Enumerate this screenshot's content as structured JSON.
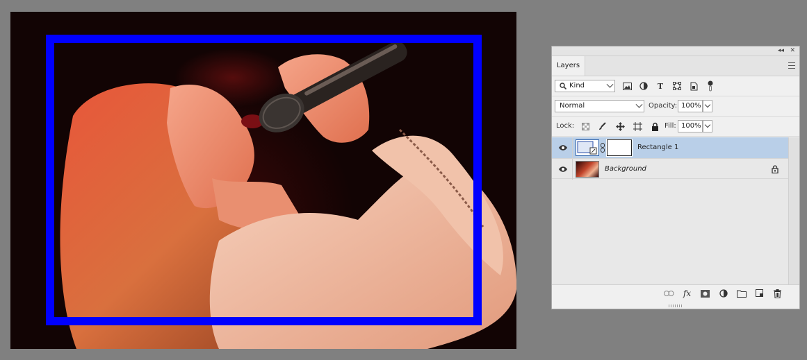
{
  "panel": {
    "tab_label": "Layers",
    "collapse_glyph": "◂◂",
    "close_glyph": "✕",
    "filter": {
      "kind_value": "Kind",
      "icons": [
        "image-filter-icon",
        "adjustment-filter-icon",
        "type-filter-icon",
        "shape-filter-icon",
        "smart-object-filter-icon",
        "filter-toggle-icon"
      ]
    },
    "blend_mode": "Normal",
    "opacity_label": "Opacity:",
    "opacity_value": "100%",
    "lock_label": "Lock:",
    "fill_label": "Fill:",
    "fill_value": "100%",
    "layers": [
      {
        "name": "Rectangle 1",
        "selected": true
      },
      {
        "name": "Background",
        "selected": false,
        "locked": true
      }
    ],
    "footer_icons": [
      "link-layers-icon",
      "fx-icon",
      "add-mask-icon",
      "new-fill-adjustment-icon",
      "new-group-icon",
      "new-layer-icon",
      "delete-layer-icon"
    ],
    "fx_label": "fx"
  },
  "colors": {
    "frame_blue": "#0000ff",
    "selection": "#b9cfe8",
    "workspace": "#808080"
  }
}
